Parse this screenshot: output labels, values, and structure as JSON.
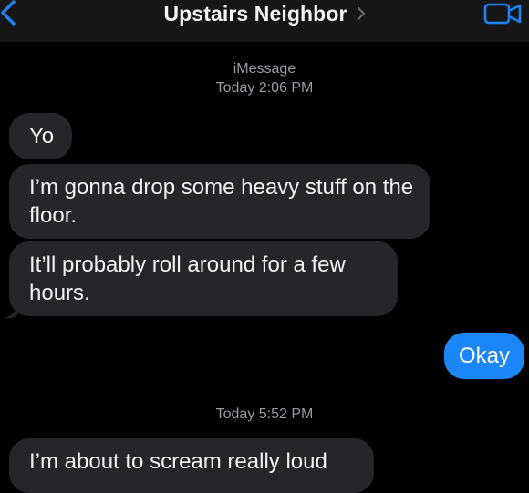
{
  "header": {
    "contact_name": "Upstairs Neighbor"
  },
  "thread": {
    "service": "iMessage",
    "timestamps": [
      {
        "day": "Today",
        "time": "2:06 PM"
      },
      {
        "day": "Today",
        "time": "5:52 PM"
      }
    ],
    "messages": [
      {
        "direction": "incoming",
        "text": "Yo"
      },
      {
        "direction": "incoming",
        "text": "I’m gonna drop some heavy stuff on the floor."
      },
      {
        "direction": "incoming",
        "text": "It’ll probably roll around for a few hours."
      },
      {
        "direction": "outgoing",
        "text": "Okay"
      },
      {
        "direction": "incoming",
        "text": "I’m about to scream really loud"
      }
    ]
  },
  "colors": {
    "background": "#000000",
    "header": "#161616",
    "incoming_bubble": "#262629",
    "outgoing_bubble": "#1b86f7",
    "accent": "#1a84f5",
    "meta_text": "#9b9ba0"
  },
  "icons": {
    "back": "chevron-left-icon",
    "title_chevron": "chevron-right-icon",
    "video_call": "video-camera-icon"
  }
}
